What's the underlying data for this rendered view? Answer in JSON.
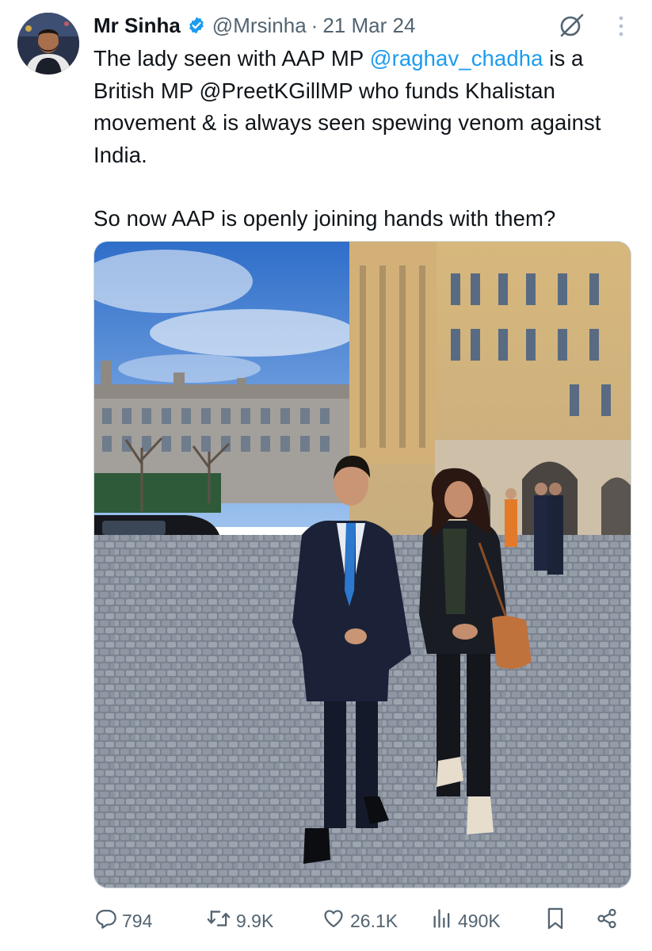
{
  "author": {
    "name": "Mr Sinha",
    "handle": "@Mrsinha",
    "separator": "·",
    "date": "21 Mar 24",
    "verified": true
  },
  "tweet": {
    "line1_pre": "The lady seen with AAP MP ",
    "mention1": "@raghav_chadha",
    "line1_post": " is a British MP @PreetKGillMP who funds Khalistan movement & is always seen spewing venom against India.",
    "paragraph2": "So now AAP is openly joining hands with them?"
  },
  "media": {
    "icon": "photo"
  },
  "actions": {
    "reply_count": "794",
    "retweet_count": "9.9K",
    "like_count": "26.1K",
    "views_count": "490K"
  },
  "icons": {
    "grok": "grok-icon",
    "more": "more-icon",
    "reply": "reply-icon",
    "retweet": "retweet-icon",
    "like": "heart-icon",
    "views": "views-icon",
    "bookmark": "bookmark-icon",
    "share": "share-icon"
  },
  "colors": {
    "link": "#1d9bf0",
    "secondary_text": "#536471",
    "verified": "#1d9bf0"
  }
}
